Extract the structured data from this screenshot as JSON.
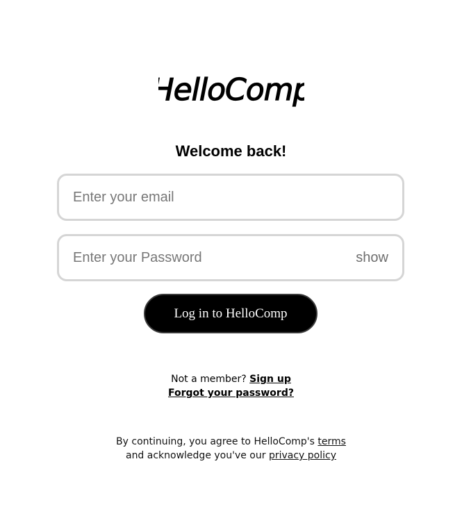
{
  "logo": {
    "text": "HelloComp"
  },
  "heading": "Welcome back!",
  "email_field": {
    "placeholder": "Enter your email",
    "value": ""
  },
  "password_field": {
    "placeholder": "Enter your Password",
    "value": "",
    "toggle_label": "show"
  },
  "login_button": {
    "label": "Log in to HelloComp"
  },
  "signup_prompt": {
    "text": "Not a member? ",
    "link": "Sign up"
  },
  "forgot_password": {
    "link": "Forgot your password?"
  },
  "legal": {
    "line1_prefix": "By continuing, you agree to HelloComp's ",
    "terms_link": "terms",
    "line2_prefix": "and acknowledge you've our ",
    "privacy_link": "privacy policy"
  },
  "colors": {
    "background": "#ffffff",
    "button_bg": "#000000",
    "button_text": "#ffffff",
    "field_border": "#d5d5d5",
    "placeholder": "#777777"
  }
}
